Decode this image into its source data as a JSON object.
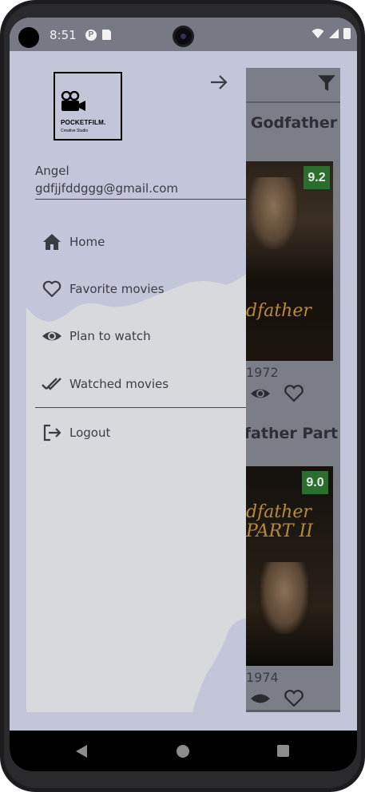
{
  "status_bar": {
    "time": "8:51",
    "notification_icons": [
      "p-badge-icon",
      "sd-card-icon"
    ],
    "system_icons": [
      "wifi-icon",
      "signal-icon",
      "battery-icon"
    ]
  },
  "drawer": {
    "logo": {
      "name": "POCKETFILM.",
      "subtitle": "Creative Studio"
    },
    "user": {
      "name": "Angel",
      "email": "gdfjjfddggg@gmail.com"
    },
    "menu": [
      {
        "label": "Home",
        "icon": "home-icon"
      },
      {
        "label": "Favorite movies",
        "icon": "heart-outline-icon"
      },
      {
        "label": "Plan to watch",
        "icon": "eye-icon"
      },
      {
        "label": "Watched movies",
        "icon": "double-check-icon"
      }
    ],
    "logout": {
      "label": "Logout",
      "icon": "logout-icon"
    }
  },
  "background_app": {
    "toolbar_icon": "filter-icon",
    "movies": [
      {
        "title": "Godfather",
        "rating": "9.2",
        "year": "1972",
        "poster_text": "dfather"
      },
      {
        "title": "dfather Part II",
        "rating": "9.0",
        "year": "1974",
        "poster_text": "dfather PART II"
      }
    ]
  },
  "colors": {
    "scrim": "#c3c6d8",
    "drawer": "#d8d9dd",
    "rating_badge": "#2b6e2e",
    "status_bar": "#777a84"
  }
}
